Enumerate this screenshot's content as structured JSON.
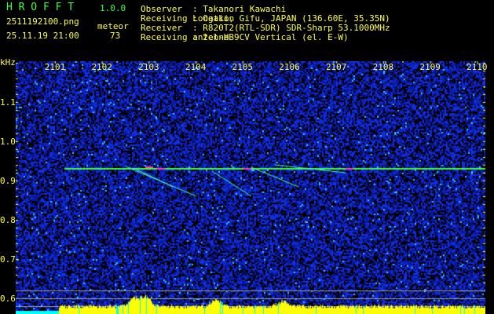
{
  "app": {
    "title": "H R O F F T",
    "version": "1.0.0"
  },
  "file": {
    "name": "2511192100.png",
    "datetime": "25.11.19 21:00",
    "meteor_label": "meteor",
    "meteor_count": "73"
  },
  "info": [
    {
      "label": "Observer",
      "value": ": Takanori Kawachi"
    },
    {
      "label": "Receiving Location",
      "value": ": Ogaki, Gifu, JAPAN (136.60E, 35.35N)"
    },
    {
      "label": "Receiver",
      "value": ": R820T2(RTL-SDR) SDR-Sharp 53.1000MHz"
    },
    {
      "label": "Receiving antenna",
      "value": ": 2el-HB9CV Vertical (el. E-W)"
    }
  ],
  "axis": {
    "unit": "kHz",
    "y_ticks": [
      "1.1",
      "1.0",
      "0.9",
      "0.8",
      "0.7",
      "0.6"
    ],
    "x_ticks": [
      "2101",
      "2102",
      "2103",
      "2104",
      "2105",
      "2106",
      "2107",
      "2108",
      "2109",
      "2110"
    ]
  },
  "colors": {
    "title": "#40ff40",
    "text": "#ffff40",
    "carrier": "#40ff40",
    "spectrum": "#ffff00",
    "baseline": "#00ffff"
  }
}
